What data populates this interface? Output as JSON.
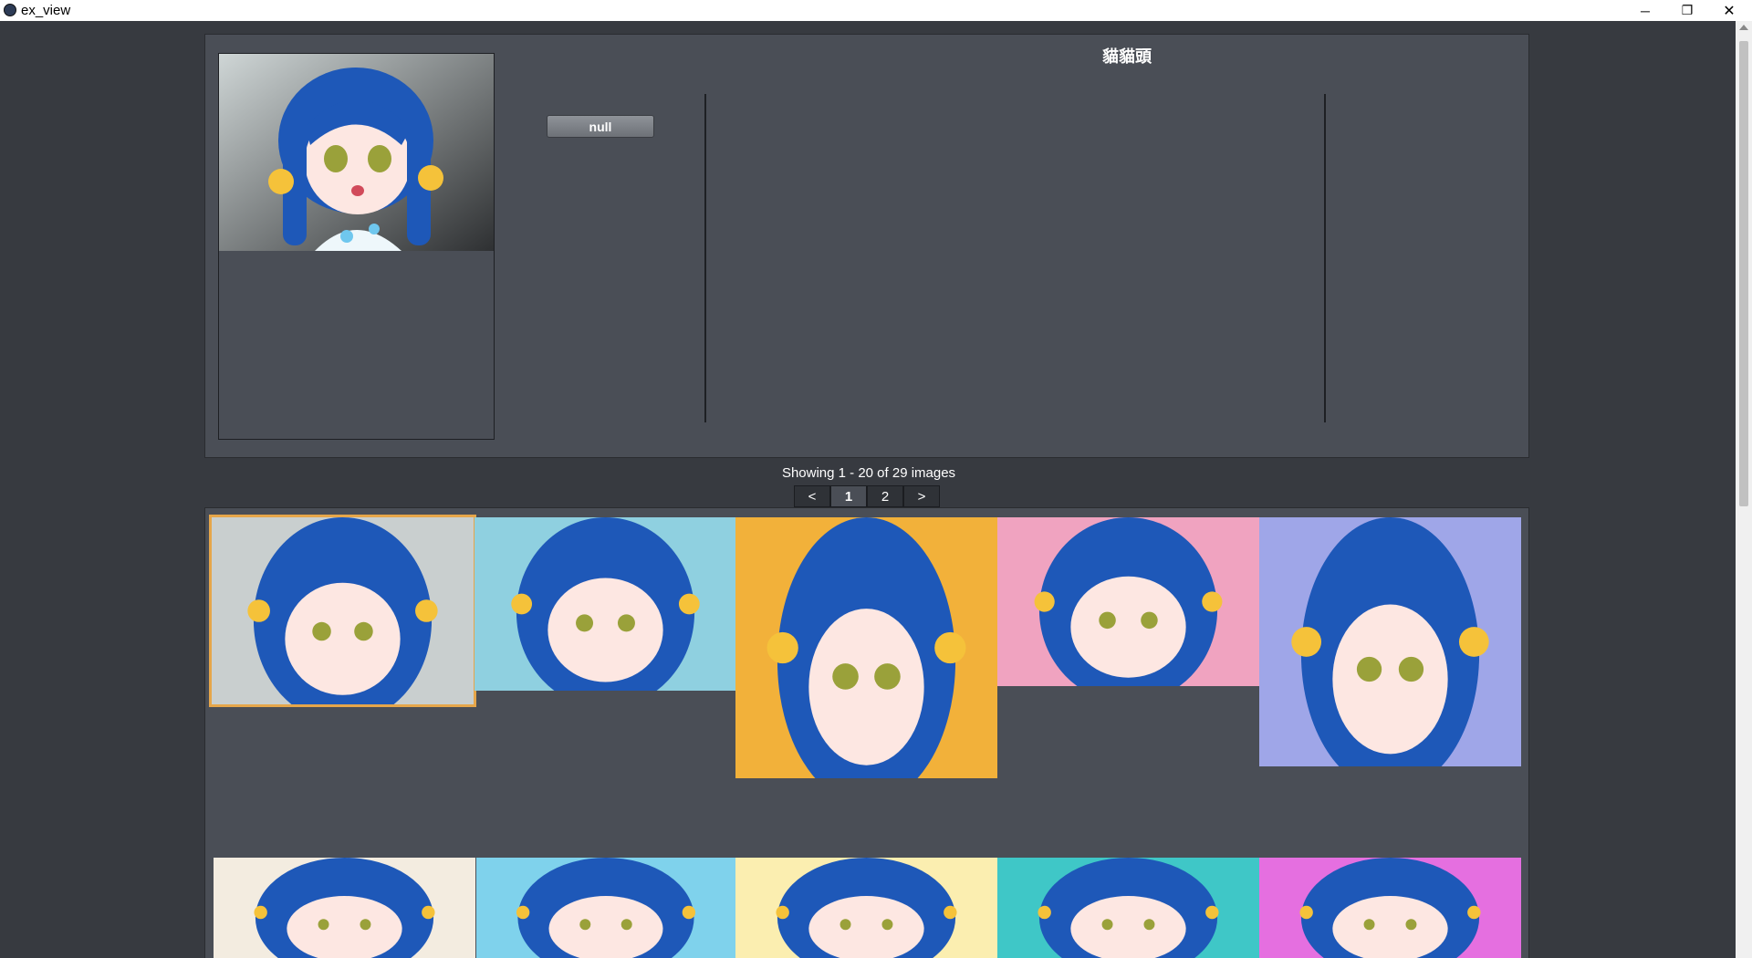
{
  "window": {
    "title": "ex_view",
    "minimize": "─",
    "maximize": "❐",
    "close": "✕"
  },
  "detail": {
    "title": "貓貓頭",
    "action_button": "null"
  },
  "pagination": {
    "summary": "Showing 1 - 20 of 29 images",
    "prev": "<",
    "pages": [
      "1",
      "2"
    ],
    "current_page": "1",
    "next": ">"
  },
  "thumbnails": [
    {
      "bg": "#c9cfcf",
      "selected": true
    },
    {
      "bg": "#8fd0e0",
      "selected": false
    },
    {
      "bg": "#f2b13a",
      "selected": false
    },
    {
      "bg": "#f0a3c0",
      "selected": false
    },
    {
      "bg": "#9fa6e8",
      "selected": false
    },
    {
      "bg": "#f3ece0",
      "selected": false
    },
    {
      "bg": "#7fd2ec",
      "selected": false
    },
    {
      "bg": "#fbeeb0",
      "selected": false
    },
    {
      "bg": "#3fc7c7",
      "selected": false
    },
    {
      "bg": "#e56fe0",
      "selected": false
    }
  ]
}
